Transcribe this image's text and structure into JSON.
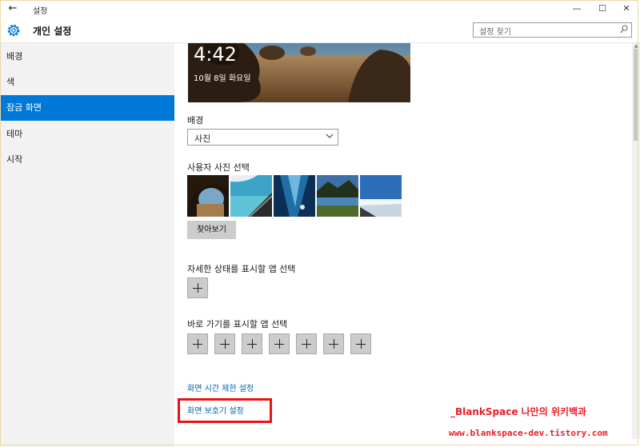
{
  "window": {
    "back_glyph": "←",
    "title": "설정",
    "minimize_glyph": "—",
    "maximize_glyph": "☐",
    "close_glyph": "✕"
  },
  "header": {
    "title": "개인 설정",
    "search_placeholder": "설정 찾기"
  },
  "sidebar": {
    "items": [
      {
        "label": "배경"
      },
      {
        "label": "색"
      },
      {
        "label": "잠금 화면",
        "active": true
      },
      {
        "label": "테마"
      },
      {
        "label": "시작"
      }
    ]
  },
  "preview": {
    "time": "4:42",
    "date": "10월 8일 화요일"
  },
  "background_section": {
    "label": "배경",
    "selected": "사진"
  },
  "user_photos": {
    "label": "사용자 사진 선택",
    "browse_label": "찾아보기",
    "count": 5
  },
  "detailed_status": {
    "label": "자세한 상태를 표시할 앱 선택",
    "slots": 1
  },
  "quick_status": {
    "label": "바로 가기를 표시할 앱 선택",
    "slots": 7
  },
  "links": {
    "screen_timeout": "화면 시간 제한 설정",
    "screen_saver": "화면 보호기 설정"
  },
  "watermark": {
    "line1": "_BlankSpace 나만의 위키백과",
    "line2": "www.blankspace-dev.tistory.com"
  },
  "colors": {
    "accent": "#0078d7",
    "link": "#0063b1",
    "highlight": "#ee1111",
    "watermark": "#ee1c25"
  }
}
